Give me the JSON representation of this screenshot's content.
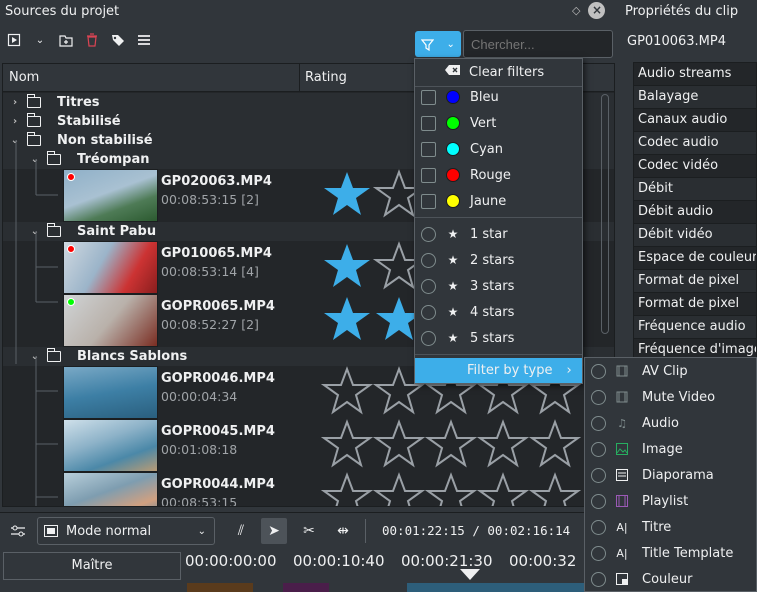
{
  "bin": {
    "title": "Sources du projet",
    "search_placeholder": "Chercher...",
    "columns": [
      "Nom",
      "Rating"
    ],
    "folders": [
      {
        "label": "Titres"
      },
      {
        "label": "Stabilisé"
      },
      {
        "label": "Non stabilisé"
      },
      {
        "label": "Tréompan"
      },
      {
        "label": "Saint Pabu"
      },
      {
        "label": "Blancs Sablons"
      }
    ],
    "clips": [
      {
        "name": "GP020063.MP4",
        "duration": "00:08:53:15 [2]",
        "tag_color": "#ff0000",
        "rating": 1
      },
      {
        "name": "GP010065.MP4",
        "duration": "00:08:53:14 [4]",
        "tag_color": "#ff0000",
        "rating": 1
      },
      {
        "name": "GOPR0065.MP4",
        "duration": "00:08:52:27 [2]",
        "tag_color": "#00ff00",
        "rating": 2
      },
      {
        "name": "GOPR0046.MP4",
        "duration": "00:00:04:34",
        "tag_color": "",
        "rating": 0
      },
      {
        "name": "GOPR0045.MP4",
        "duration": "00:01:08:18",
        "tag_color": "",
        "rating": 0
      },
      {
        "name": "GOPR0044.MP4",
        "duration": "00:08:53:15",
        "tag_color": "",
        "rating": 0
      }
    ]
  },
  "filter_menu": {
    "clear": "Clear filters",
    "tags": [
      {
        "label": "Bleu",
        "color": "#0000ff"
      },
      {
        "label": "Vert",
        "color": "#00ff00"
      },
      {
        "label": "Cyan",
        "color": "#00ffff"
      },
      {
        "label": "Rouge",
        "color": "#ff0000"
      },
      {
        "label": "Jaune",
        "color": "#ffff00"
      }
    ],
    "ratings": [
      "1 star",
      "2 stars",
      "3 stars",
      "4 stars",
      "5 stars"
    ],
    "by_type": "Filter by type"
  },
  "type_submenu": [
    {
      "label": "AV Clip",
      "icon": "film-icon"
    },
    {
      "label": "Mute Video",
      "icon": "film-icon"
    },
    {
      "label": "Audio",
      "icon": "music-note-icon"
    },
    {
      "label": "Image",
      "icon": "image-icon"
    },
    {
      "label": "Diaporama",
      "icon": "slideshow-icon"
    },
    {
      "label": "Playlist",
      "icon": "playlist-icon"
    },
    {
      "label": "Titre",
      "icon": "title-icon"
    },
    {
      "label": "Title Template",
      "icon": "title-icon"
    },
    {
      "label": "Couleur",
      "icon": "color-icon"
    }
  ],
  "props": {
    "title": "Propriétés du clip",
    "file": "GP010063.MP4",
    "items": [
      "Audio streams",
      "Balayage",
      "Canaux audio",
      "Codec audio",
      "Codec vidéo",
      "Débit",
      "Débit audio",
      "Débit vidéo",
      "Espace de couleur",
      "Format de pixel",
      "Format de pixel",
      "Fréquence audio",
      "Fréquence d'image"
    ]
  },
  "timeline": {
    "mode": "Mode normal",
    "position": "00:01:22:15",
    "separator": "/",
    "total": "00:02:16:14",
    "master": "Maître",
    "ruler_labels": [
      "00:00:00:00",
      "00:00:10:40",
      "00:00:21:30",
      "00:00:32"
    ]
  },
  "colors": {
    "accent": "#3daee9",
    "star": "#3daee9"
  }
}
